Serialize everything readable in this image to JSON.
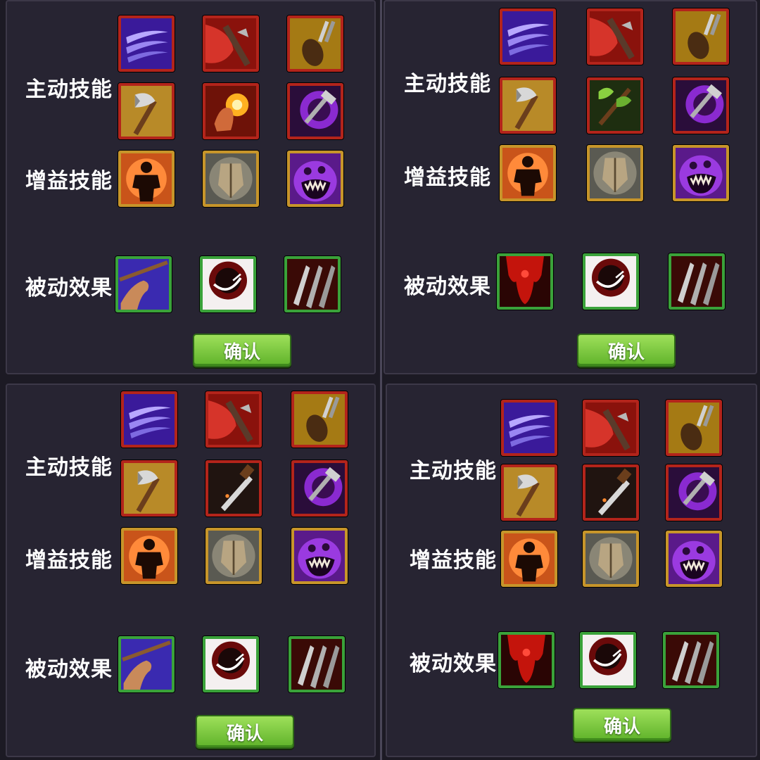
{
  "labels": {
    "active": "主动技能",
    "buff": "增益技能",
    "passive": "被动效果",
    "confirm": "确认"
  },
  "panels": [
    {
      "active": [
        "scythe-slash-icon",
        "blood-axe-icon",
        "iron-boot-icon",
        "war-axe-icon",
        "fire-fist-icon",
        "shadow-hammer-icon"
      ],
      "buff": [
        "rage-silhouette-icon",
        "stone-shield-icon",
        "purple-monster-icon"
      ],
      "passive": [
        "strong-arm-icon",
        "blood-orb-icon",
        "triple-blades-icon"
      ]
    },
    {
      "active": [
        "scythe-slash-icon",
        "blood-axe-icon",
        "iron-boot-icon",
        "war-axe-icon",
        "green-double-axe-icon",
        "shadow-hammer-icon"
      ],
      "buff": [
        "rage-silhouette-icon",
        "stone-shield-icon",
        "purple-monster-icon"
      ],
      "passive": [
        "blood-drip-icon",
        "blood-orb-icon",
        "triple-blades-icon"
      ]
    },
    {
      "active": [
        "scythe-slash-icon",
        "blood-axe-icon",
        "iron-boot-icon",
        "war-axe-icon",
        "sword-strike-icon",
        "shadow-hammer-icon"
      ],
      "buff": [
        "rage-silhouette-icon",
        "stone-shield-icon",
        "purple-monster-icon"
      ],
      "passive": [
        "strong-arm-icon",
        "blood-orb-icon",
        "triple-blades-icon"
      ]
    },
    {
      "active": [
        "scythe-slash-icon",
        "blood-axe-icon",
        "iron-boot-icon",
        "war-axe-icon",
        "sword-strike-icon",
        "shadow-hammer-icon"
      ],
      "buff": [
        "rage-silhouette-icon",
        "stone-shield-icon",
        "purple-monster-icon"
      ],
      "passive": [
        "blood-drip-icon",
        "blood-orb-icon",
        "triple-blades-icon"
      ]
    }
  ],
  "colors": {
    "active_border": "#b3241b",
    "buff_border": "#c7952a",
    "passive_border": "#3aa23a",
    "confirm_button": "#7cc63f"
  }
}
